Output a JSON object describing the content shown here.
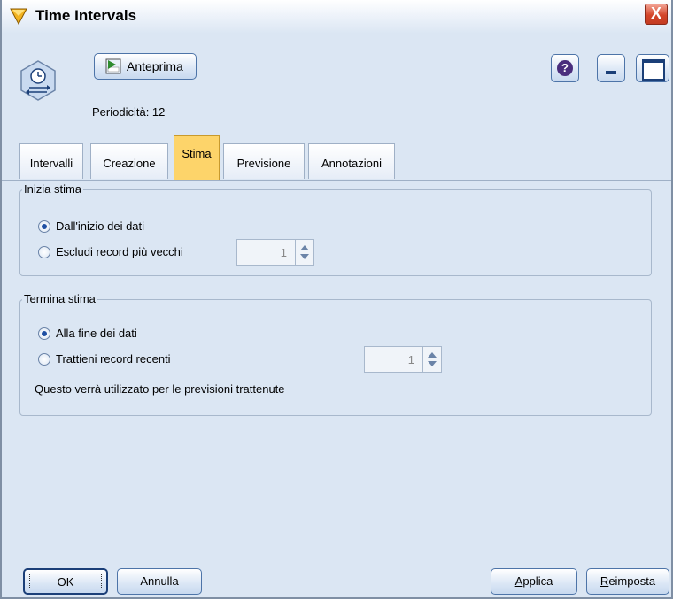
{
  "window": {
    "title": "Time Intervals",
    "close_glyph": "X"
  },
  "toolbar": {
    "preview_label": "Anteprima",
    "help_glyph": "?",
    "periodicity": "Periodicità: 12"
  },
  "tabs": [
    {
      "label": "Intervalli",
      "active": false
    },
    {
      "label": "Creazione",
      "active": false
    },
    {
      "label": "Stima",
      "active": true
    },
    {
      "label": "Previsione",
      "active": false
    },
    {
      "label": "Annotazioni",
      "active": false
    }
  ],
  "start_estimate": {
    "legend": "Inizia stima",
    "options": [
      {
        "label": "Dall'inizio dei dati",
        "checked": true
      },
      {
        "label": "Escludi record più vecchi",
        "checked": false
      }
    ],
    "spinner_value": "1"
  },
  "end_estimate": {
    "legend": "Termina stima",
    "options": [
      {
        "label": "Alla fine dei dati",
        "checked": true
      },
      {
        "label": "Trattieni record recenti",
        "checked": false
      }
    ],
    "spinner_value": "1",
    "note": "Questo verrà utilizzato per le previsioni trattenute"
  },
  "buttons": {
    "ok": "OK",
    "cancel": "Annulla",
    "apply_prefix": "",
    "apply_underlined": "A",
    "apply_rest": "pplica",
    "reset_underlined": "R",
    "reset_rest": "eimposta"
  },
  "colors": {
    "active_tab": "#fdd46a",
    "panel_background": "#dbe6f3",
    "close_button": "#d4462a"
  },
  "icons": {
    "title": "time-intervals-node-icon",
    "node": "clock-node-icon",
    "preview": "play-preview-icon",
    "help": "help-icon",
    "minimize": "minimize-icon",
    "maximize": "maximize-icon",
    "close": "close-icon"
  }
}
